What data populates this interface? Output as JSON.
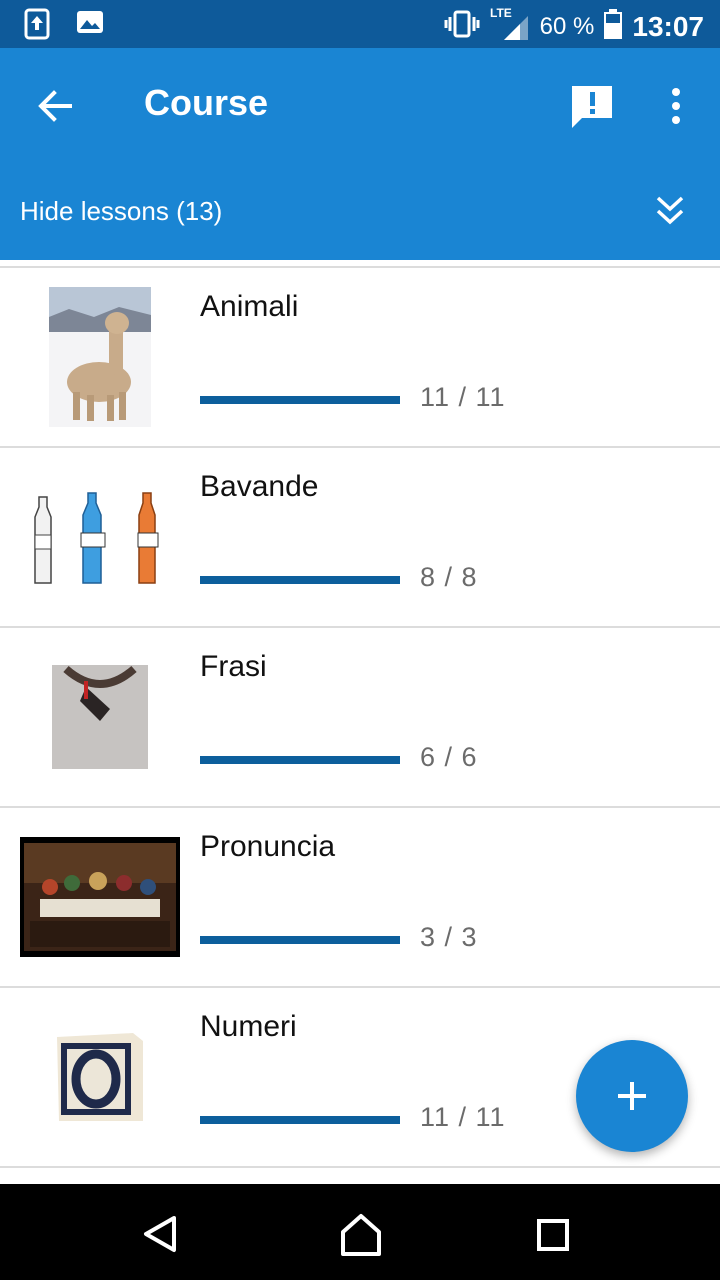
{
  "status_bar": {
    "icons_left": [
      "upload-notification-icon",
      "image-notification-icon"
    ],
    "icons_right": [
      "vibrate-icon",
      "lte-signal-icon",
      "battery-icon"
    ],
    "network": "LTE",
    "battery": "60 %",
    "time": "13:07"
  },
  "app_bar": {
    "title": "Course",
    "back_icon": "arrow-left-icon",
    "feedback_icon": "feedback-icon",
    "more_icon": "more-vertical-icon",
    "lessons_toggle_label": "Hide lessons (13)",
    "lessons_toggle_icon": "double-chevron-down-icon"
  },
  "lessons": [
    {
      "name": "Animali",
      "progress": "11 / 11",
      "completed": 11,
      "total": 11,
      "thumb": "alpaca-image"
    },
    {
      "name": "Bavande",
      "progress": "8 / 8",
      "completed": 8,
      "total": 8,
      "thumb": "bottles-image"
    },
    {
      "name": "Frasi",
      "progress": "6 / 6",
      "completed": 6,
      "total": 6,
      "thumb": "tshirt-image"
    },
    {
      "name": "Pronuncia",
      "progress": "3 / 3",
      "completed": 3,
      "total": 3,
      "thumb": "painting-image"
    },
    {
      "name": "Numeri",
      "progress": "11 / 11",
      "completed": 11,
      "total": 11,
      "thumb": "block-image"
    }
  ],
  "fab": {
    "icon": "plus-icon"
  },
  "nav_bar": {
    "icons": [
      "nav-back-icon",
      "nav-home-icon",
      "nav-recents-icon"
    ]
  },
  "colors": {
    "status_bar": "#0e5a9a",
    "app_bar": "#1a85d3",
    "progress": "#0d5f9c",
    "fab": "#1a85d3"
  }
}
